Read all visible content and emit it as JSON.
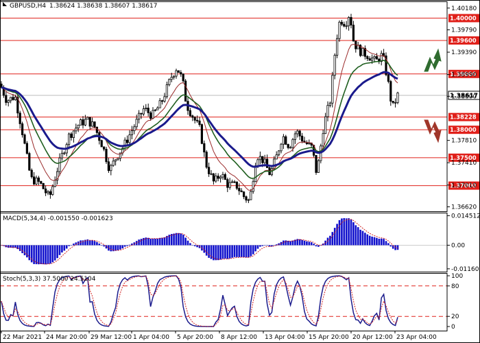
{
  "header": {
    "symbol": "GBPUSD,H4",
    "ohlc": "1.38624 1.38638 1.38607 1.38617"
  },
  "colors": {
    "candle": "#000000",
    "level": "#e0201a",
    "ma_blue": "#1a1a8c",
    "ma_green": "#1f5f1f",
    "ma_red": "#9a2a2a",
    "macd_bar": "#1010cc",
    "signal": "#d02020",
    "arrow_up": "#2f6b2f",
    "arrow_down": "#a0362a"
  },
  "price_axis": {
    "ticks": [
      "1.40180",
      "1.39790",
      "1.39390",
      "1.38990",
      "1.38600",
      "1.37810",
      "1.37410",
      "1.37010",
      "1.36620"
    ],
    "levels": [
      "1.40000",
      "1.39600",
      "1.39000",
      "1.38228",
      "1.38000",
      "1.37500",
      "1.37000"
    ],
    "current_price": "1.38617"
  },
  "macd": {
    "label": "MACD(5,34,4) -0.001550 -0.001623",
    "ticks": [
      "0.014512",
      "0.00",
      "-0.011603"
    ]
  },
  "stoch": {
    "label": "Stoch(5,3,3) 37.5000 24.5104",
    "ticks": [
      "100",
      "80",
      "20",
      "0"
    ]
  },
  "time_axis": [
    "22 Mar 2021",
    "24 Mar 20:00",
    "29 Mar 12:00",
    "1 Apr 04:00",
    "5 Apr 20:00",
    "8 Apr 12:00",
    "13 Apr 04:00",
    "15 Apr 20:00",
    "20 Apr 12:00",
    "23 Apr 04:00"
  ],
  "signals": {
    "up": "arrow-up",
    "down": "arrow-down"
  }
}
